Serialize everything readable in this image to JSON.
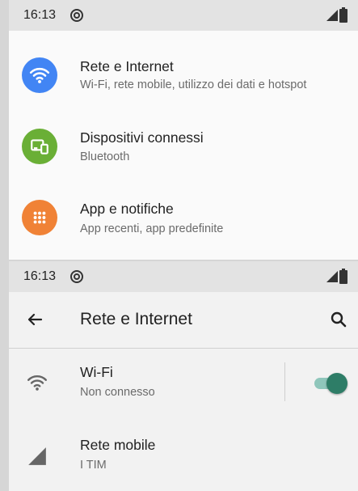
{
  "settings_screen": {
    "status_bar": {
      "time": "16:13"
    },
    "items": [
      {
        "title": "Rete e Internet",
        "subtitle": "Wi-Fi, rete mobile, utilizzo dei dati e hotspot",
        "icon": "wifi-icon",
        "color": "#4285f4"
      },
      {
        "title": "Dispositivi connessi",
        "subtitle": "Bluetooth",
        "icon": "devices-icon",
        "color": "#6aaf36"
      },
      {
        "title": "App e notifiche",
        "subtitle": "App recenti, app predefinite",
        "icon": "apps-grid-icon",
        "color": "#f08236"
      }
    ]
  },
  "network_screen": {
    "status_bar": {
      "time": "16:13"
    },
    "toolbar": {
      "title": "Rete e Internet",
      "back_icon": "back-arrow-icon",
      "search_icon": "search-icon"
    },
    "wifi": {
      "title": "Wi-Fi",
      "subtitle": "Non connesso",
      "icon": "wifi-icon",
      "toggle_on": true,
      "accent": "#2e7d67"
    },
    "mobile": {
      "title": "Rete mobile",
      "subtitle": "I TIM",
      "icon": "cell-signal-icon"
    }
  }
}
